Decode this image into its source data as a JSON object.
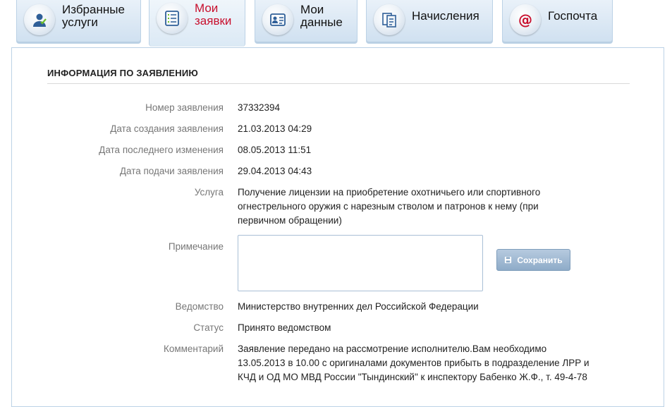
{
  "tabs": [
    {
      "label": "Избранные услуги",
      "icon": "favorite-services-icon",
      "active": false
    },
    {
      "label": "Мои заявки",
      "icon": "my-requests-icon",
      "active": true
    },
    {
      "label": "Мои данные",
      "icon": "my-data-icon",
      "active": false
    },
    {
      "label": "Начисления",
      "icon": "charges-icon",
      "active": false
    },
    {
      "label": "Госпочта",
      "icon": "gov-mail-icon",
      "active": false
    }
  ],
  "section": {
    "title": "ИНФОРМАЦИЯ ПО ЗАЯВЛЕНИЮ"
  },
  "fields": {
    "number": {
      "label": "Номер заявления",
      "value": "37332394"
    },
    "created": {
      "label": "Дата создания заявления",
      "value": "21.03.2013 04:29"
    },
    "modified": {
      "label": "Дата последнего изменения",
      "value": "08.05.2013 11:51"
    },
    "submitted": {
      "label": "Дата подачи заявления",
      "value": "29.04.2013 04:43"
    },
    "service": {
      "label": "Услуга",
      "value": "Получение лицензии на приобретение охотничьего или спортивного огнестрельного оружия с нарезным стволом и патронов к нему (при первичном обращении)"
    },
    "note": {
      "label": "Примечание",
      "value": ""
    },
    "agency": {
      "label": "Ведомство",
      "value": "Министерство внутренних дел Российской Федерации"
    },
    "status": {
      "label": "Статус",
      "value": "Принято ведомством"
    },
    "comment": {
      "label": "Комментарий",
      "value": "Заявление передано на рассмотрение исполнителю.Вам необходимо 13.05.2013 в 10.00 с оригиналами документов прибыть в подразделение ЛРР и КЧД и ОД МО МВД России \"Тындинский\" к инспектору Бабенко Ж.Ф., т. 49-4-78"
    }
  },
  "save_button": {
    "label": "Сохранить",
    "icon": "save-icon"
  },
  "colors": {
    "accent": "#c8102e",
    "tab_bg": "#dbe9f5",
    "border": "#bcd2e6",
    "button": "#9bb6d2"
  }
}
